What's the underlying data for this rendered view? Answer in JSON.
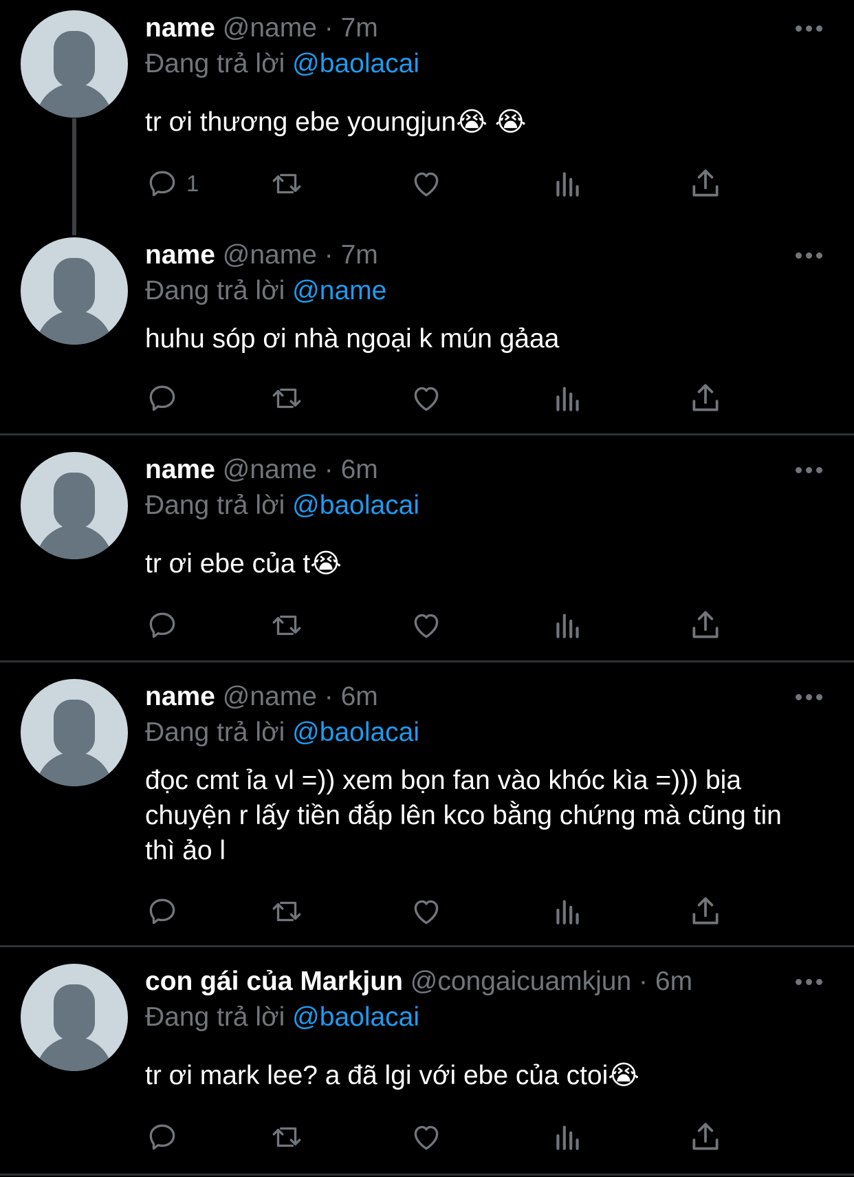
{
  "tweets": [
    {
      "display_name": "name",
      "handle": "@name",
      "time": "7m",
      "reply_label": "Đang trả lời",
      "reply_to": "@baolacai",
      "text": "tr ơi thương ebe youngjun😭 😭",
      "reply_count": "1"
    },
    {
      "display_name": "name",
      "handle": "@name",
      "time": "7m",
      "reply_label": "Đang trả lời",
      "reply_to": "@name",
      "text": "huhu sóp ơi nhà ngoại k mún gảaa",
      "reply_count": ""
    },
    {
      "display_name": "name",
      "handle": "@name",
      "time": "6m",
      "reply_label": "Đang trả lời",
      "reply_to": "@baolacai",
      "text": "tr ơi ebe của t😭",
      "reply_count": ""
    },
    {
      "display_name": "name",
      "handle": "@name",
      "time": "6m",
      "reply_label": "Đang trả lời",
      "reply_to": "@baolacai",
      "text": "đọc cmt ỉa vl =)) xem bọn fan vào khóc kìa =))) bịa chuyện r lấy tiền đắp lên kco bằng chứng mà cũng tin thì ảo l",
      "reply_count": ""
    },
    {
      "display_name": "con gái của Markjun",
      "handle": "@congaicuamkjun",
      "time": "6m",
      "reply_label": "Đang trả lời",
      "reply_to": "@baolacai",
      "text": "tr ơi mark lee? a đã lgi với ebe của ctoi😭",
      "reply_count": ""
    }
  ],
  "separator": "·",
  "icons": {
    "reply": "reply-icon",
    "retweet": "retweet-icon",
    "like": "like-icon",
    "views": "views-icon",
    "share": "share-icon",
    "more": "more-icon"
  },
  "colors": {
    "background": "#000000",
    "mention": "#1d9bf0",
    "muted": "#71767b"
  }
}
